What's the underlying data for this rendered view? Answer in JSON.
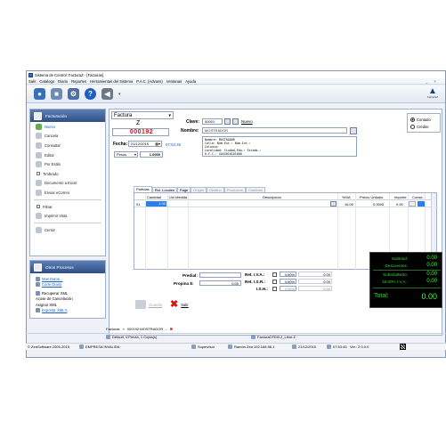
{
  "window": {
    "title": "Sistema de Control: FacturaZ - [Facturas]",
    "controls": "_ ×"
  },
  "menu": [
    "Salir",
    "Catalogo",
    "Diario",
    "Reportes",
    "Herramientas del Sistema",
    "P.A.C. (Advans)",
    "Ventanas",
    "Ayuda"
  ],
  "toolbar": {
    "icons": [
      "users-icon",
      "company-icon",
      "user-settings-icon",
      "help-icon",
      "exit-icon"
    ],
    "logo_text": "FacturaZ"
  },
  "sidebar": {
    "facturacion": {
      "title": "Facturación",
      "items": [
        {
          "label": "Nuevo",
          "active": true
        },
        {
          "label": "Cancela"
        },
        {
          "label": "Consultar"
        },
        {
          "label": "Editar"
        },
        {
          "label": "Por Estilo"
        },
        {
          "label": "Timbrado",
          "checkbox": true
        },
        {
          "label": "Documento a Excel"
        },
        {
          "label": "Enviar eCorreo"
        },
        {
          "label": "Filtrar",
          "checkbox": true
        },
        {
          "label": "Imprimir Vista"
        },
        {
          "label": "Cerrar"
        }
      ]
    },
    "otros": {
      "title": "Otros Procesos",
      "items": [
        {
          "label": "Mas Datos...",
          "link": true
        },
        {
          "label": "Corte Diario",
          "link": true
        },
        {
          "label": "Recuperar XML"
        },
        {
          "label": "Acuse de Cancelación"
        },
        {
          "label": "Asignar XML"
        },
        {
          "label": "Exportar XML's",
          "link": true
        }
      ]
    }
  },
  "form": {
    "doc_type": "Factura",
    "series": "Z",
    "folio": "000192",
    "clave_label": "Clave:",
    "clave": "00001",
    "nuevo": "Nuevo",
    "nombre_label": "Nombre:",
    "nombre": "MOSTRADOR",
    "fecha_label": "Fecha:",
    "fecha": "21/12/2015",
    "hora": "07:53:45",
    "moneda": "Pesos",
    "tipo_cambio": "1.0000",
    "address_lines": [
      "Nombre: MOSTRADOR",
      "Calle: Núm.Ext.: Núm.Int.:",
      "Colonia:",
      "Localidad: Ciudad,Edo.: Estado.:",
      "R.F.C.: XAXX010101000"
    ],
    "pago_contado": "Contado",
    "pago_credito": "Crédito"
  },
  "tabs": [
    "Partidas",
    "Ret. Locales",
    "Page",
    "Origen",
    "Destino",
    "Productos",
    "Choferes"
  ],
  "grid": {
    "headers": [
      "Cantidad",
      "Uni.Medida",
      "Descripción",
      "%IVA",
      "Precio Unitario",
      "Importe",
      "Conse..."
    ],
    "rows": [
      {
        "num": "01",
        "cantidad": "1.00",
        "unidad": "",
        "descripcion": "",
        "iva": "16.00",
        "precio": "0.0000",
        "importe": "0.00"
      }
    ]
  },
  "totals": {
    "predial_label": "Predial:",
    "propina_label": "Propina $:",
    "propina": "0.00",
    "ret_iva_label": "Ret. I.V.A.:",
    "ret_iva_pct": "4.00%",
    "ret_iva_val": "0.00",
    "ret_isr_label": "Ret. I.S.R.:",
    "ret_isr_pct": "4.00%",
    "ret_isr_val": "0.00",
    "ish_label": "I.S.H.:",
    "ish_pct": "3.00%",
    "ish_val": "0.00",
    "guardar": "Guardar",
    "salir": "Salir"
  },
  "summary": {
    "subtotal_label": "Subtotal:",
    "subtotal": "0.00",
    "descuentos_label": "-Descuentos:",
    "descuentos": "0.00",
    "subtotal_neto_label": "SubtotalNeto:",
    "subtotal_neto": "0.00",
    "iva_label": "16.00% I.V.A.:",
    "iva": "0.00",
    "total_label": "Total:",
    "total": "0.00"
  },
  "doc_tabs": {
    "label": "Facturas",
    "sep": "»",
    "current": "000192:MOSTRADOR ..."
  },
  "status": {
    "printer": "Default, V.Previa, 1 Copia(s)",
    "cfdi": "FacturaCFDi3.2_Libre.Z",
    "copyright": "© ZeaSoftware 2005-2015",
    "empresa": "EMPRESA INVALIDA",
    "user": "Supervisor",
    "server": "Ramón.Zea:192.168.56.1",
    "date": "21/12/2015",
    "time": "07:53:45",
    "version": "Ver.: 2.0.0.0"
  },
  "colors": {
    "panel_header": "#2e4f86",
    "accent": "#1c5fc0",
    "folio": "#c0151c",
    "summary_bg": "#000000",
    "summary_text": "#3fcf3f"
  }
}
